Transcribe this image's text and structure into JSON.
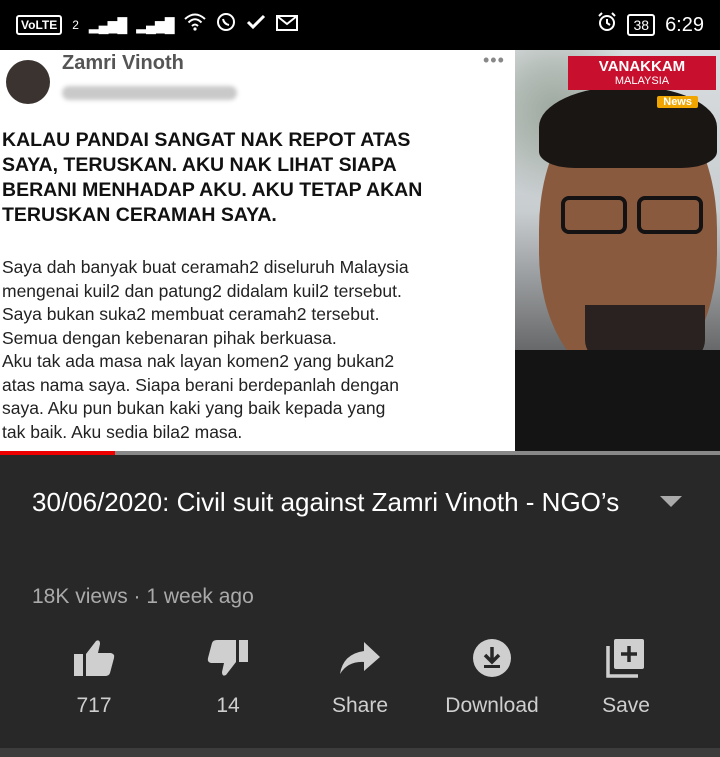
{
  "status_bar": {
    "volte": "VoLTE",
    "sim": "2",
    "battery": "38",
    "time": "6:29"
  },
  "thumbnail": {
    "poster_name": "Zamri Vinoth",
    "headline": "KALAU PANDAI SANGAT NAK REPOT ATAS\nSAYA, TERUSKAN. AKU NAK LIHAT SIAPA\nBERANI MENHADAP AKU. AKU TETAP AKAN\nTERUSKAN CERAMAH SAYA.",
    "body": "Saya dah banyak buat ceramah2 diseluruh Malaysia\nmengenai kuil2 dan patung2 didalam kuil2 tersebut.\nSaya bukan suka2 membuat ceramah2 tersebut.\nSemua dengan kebenaran pihak berkuasa.\nAku tak ada masa nak layan komen2 yang bukan2\natas nama saya. Siapa berani berdepanlah dengan\nsaya. Aku pun bukan kaki yang baik kepada yang\ntak baik. Aku sedia bila2 masa.",
    "badge_title": "VANAKKAM",
    "badge_sub": "MALAYSIA",
    "badge_news": "News",
    "playback_progress": 0.16
  },
  "video": {
    "title": "30/06/2020: Civil suit  against Zamri Vinoth - NGO’s",
    "meta": "18K views · 1 week ago"
  },
  "actions": [
    {
      "icon": "thumbs-up-icon",
      "label": "717"
    },
    {
      "icon": "thumbs-down-icon",
      "label": "14"
    },
    {
      "icon": "share-icon",
      "label": "Share"
    },
    {
      "icon": "download-icon",
      "label": "Download"
    },
    {
      "icon": "save-icon",
      "label": "Save"
    }
  ],
  "colors": {
    "background": "#282828",
    "progress": "#ff0000",
    "badge": "#c8102e"
  }
}
